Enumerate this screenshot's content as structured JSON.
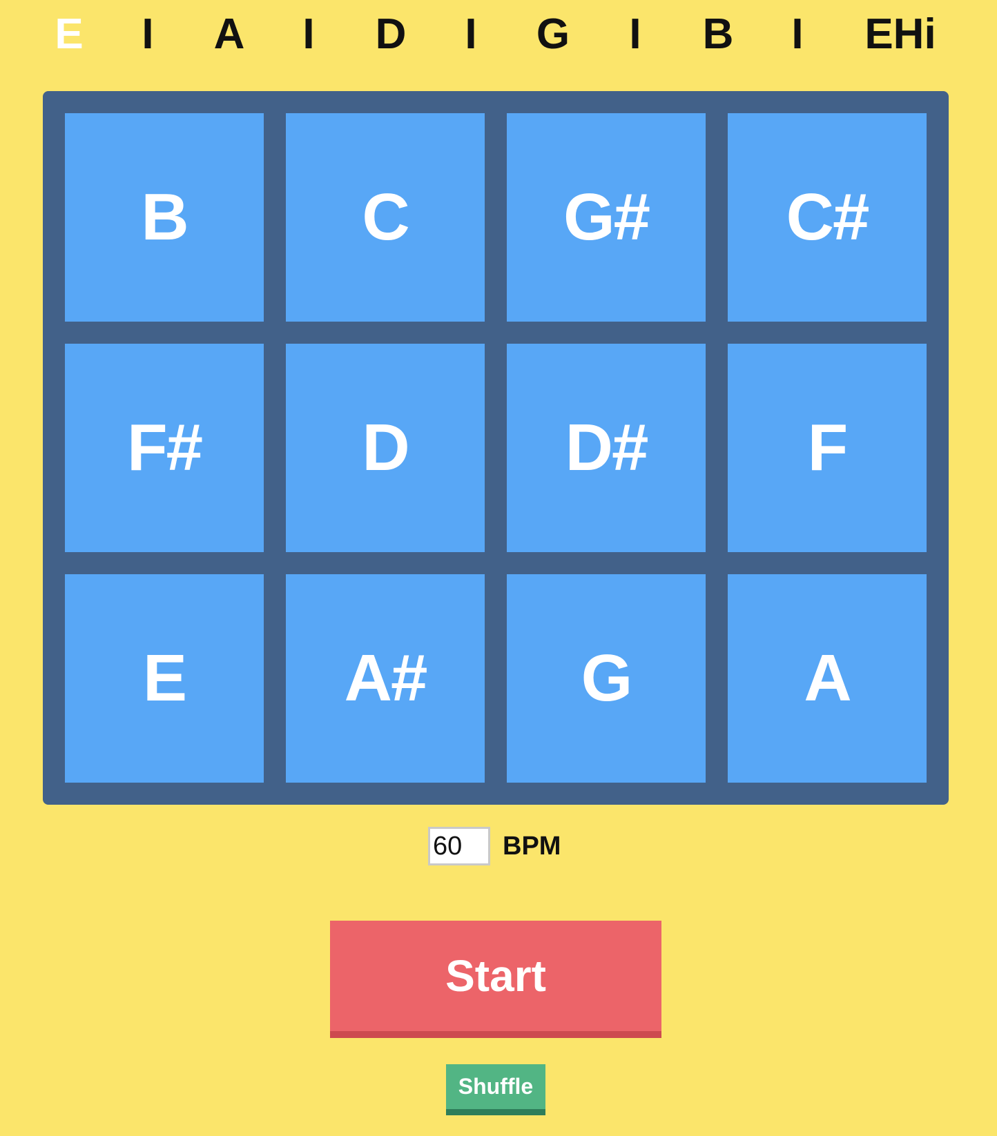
{
  "header": {
    "strings": [
      {
        "label": "E",
        "active": true
      },
      {
        "label": "A",
        "active": false
      },
      {
        "label": "D",
        "active": false
      },
      {
        "label": "G",
        "active": false
      },
      {
        "label": "B",
        "active": false
      },
      {
        "label": "EHi",
        "active": false
      }
    ],
    "divider": "I"
  },
  "board": {
    "notes": [
      "B",
      "C",
      "G#",
      "C#",
      "F#",
      "D",
      "D#",
      "F",
      "E",
      "A#",
      "G",
      "A"
    ]
  },
  "tempo": {
    "value": "60",
    "unit_label": "BPM"
  },
  "controls": {
    "start_label": "Start",
    "shuffle_label": "Shuffle"
  },
  "colors": {
    "background": "#fbe56b",
    "board": "#426189",
    "tile": "#58a7f6",
    "start": "#ec6469",
    "shuffle": "#52b584"
  }
}
